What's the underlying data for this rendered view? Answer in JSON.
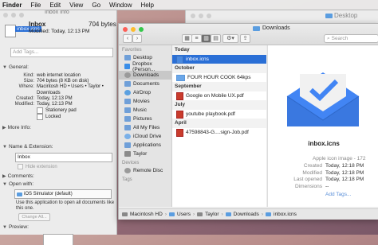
{
  "menubar": [
    "Finder",
    "File",
    "Edit",
    "View",
    "Go",
    "Window",
    "Help"
  ],
  "background_window": {
    "title": "Desktop"
  },
  "info": {
    "window_title": "Inbox Info",
    "selected_filename": "inbox.icns",
    "name": "Inbox",
    "size": "704 bytes",
    "modified_summary": "Modified: Today, 12:13 PM",
    "tags_placeholder": "Add Tags...",
    "general_label": "General:",
    "general": [
      {
        "k": "Kind:",
        "v": "web internet location"
      },
      {
        "k": "Size:",
        "v": "704 bytes (8 KB on disk)"
      },
      {
        "k": "Where:",
        "v": "Macintosh HD • Users • Taylor •"
      },
      {
        "k": "",
        "v": "Downloads"
      },
      {
        "k": "Created:",
        "v": "Today, 12:13 PM"
      },
      {
        "k": "Modified:",
        "v": "Today, 12:13 PM"
      }
    ],
    "stationery": "Stationery pad",
    "locked": "Locked",
    "more_info": "More Info:",
    "name_ext": "Name & Extension:",
    "name_value": "Inbox",
    "hide_ext": "Hide extension",
    "comments": "Comments:",
    "open_with": "Open with:",
    "open_with_app": "iOS Simulator (default)",
    "open_with_text": "Use this application to open all documents like this one.",
    "change_all": "Change All...",
    "preview": "Preview:"
  },
  "downloads": {
    "title": "Downloads",
    "search_placeholder": "Search",
    "favorites_h": "Favorites",
    "devices_h": "Devices",
    "tags_h": "Tags",
    "sidebar": [
      "Desktop",
      "Dropbox (Person...",
      "Downloads",
      "Documents",
      "AirDrop",
      "Movies",
      "Music",
      "Pictures",
      "All My Files",
      "iCloud Drive",
      "Applications",
      "Taylor"
    ],
    "devices": [
      "Remote Disc"
    ],
    "sections": [
      {
        "h": "Today",
        "items": [
          "inbox.icns"
        ]
      },
      {
        "h": "October",
        "items": [
          "FOUR HOUR COOK 64kps"
        ]
      },
      {
        "h": "September",
        "items": [
          "Google on Mobile UX.pdf"
        ]
      },
      {
        "h": "July",
        "items": [
          "youtube playbook.pdf"
        ]
      },
      {
        "h": "April",
        "items": [
          "47598843-G....sign-Job.pdf"
        ]
      }
    ],
    "preview": {
      "name": "inbox.icns",
      "kind": "Apple icon image - 172",
      "rows": [
        {
          "k": "Created",
          "v": "Today, 12:18 PM"
        },
        {
          "k": "Modified",
          "v": "Today, 12:18 PM"
        },
        {
          "k": "Last opened",
          "v": "Today, 12:18 PM"
        },
        {
          "k": "Dimensions",
          "v": "--"
        }
      ],
      "add_tags": "Add Tags..."
    },
    "path": [
      "Macintosh HD",
      "Users",
      "Taylor",
      "Downloads",
      "inbox.icns"
    ]
  }
}
